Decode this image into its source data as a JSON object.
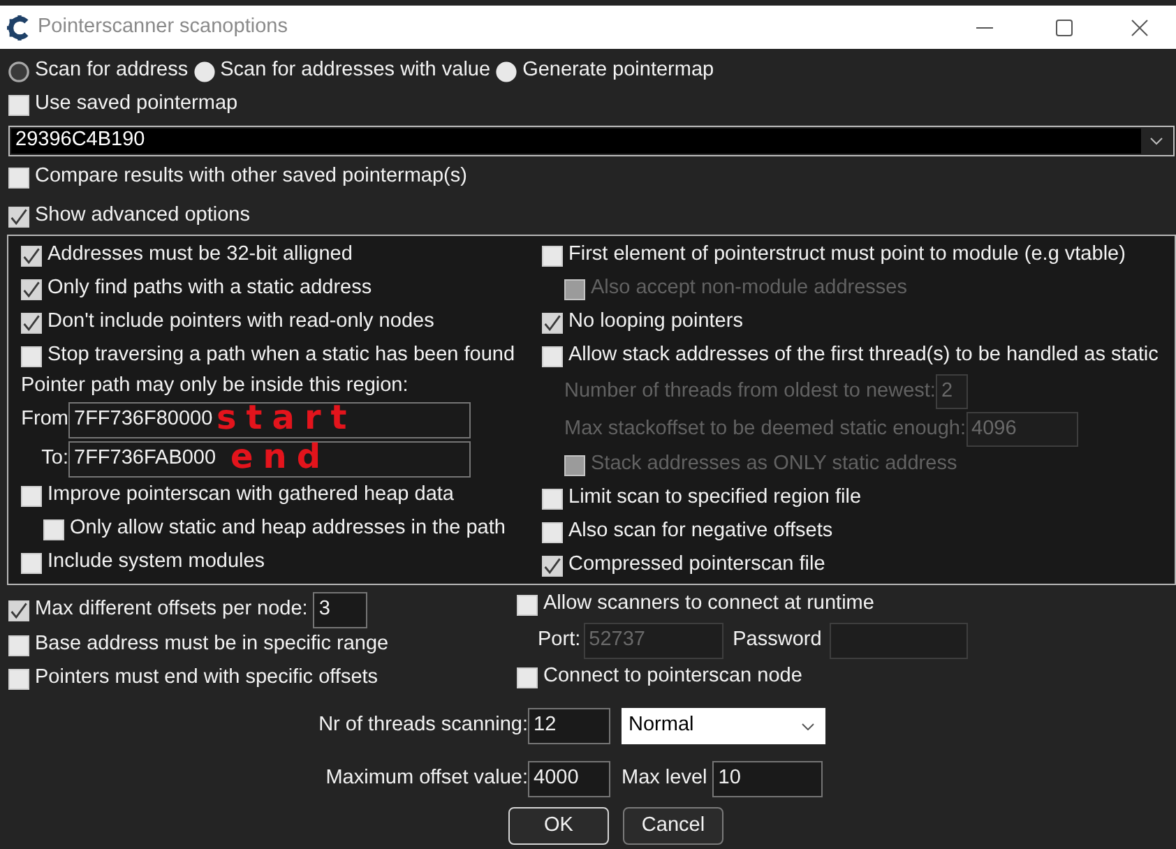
{
  "window": {
    "title": "Pointerscanner scanoptions"
  },
  "scan_modes": [
    {
      "label": "Scan for address",
      "selected": true
    },
    {
      "label": "Scan for addresses with value",
      "selected": false
    },
    {
      "label": "Generate pointermap",
      "selected": false
    }
  ],
  "use_saved_pointermap": {
    "label": "Use saved pointermap",
    "checked": false
  },
  "pointermap": {
    "value": "29396C4B190"
  },
  "compare_results": {
    "label": "Compare results with other saved pointermap(s)",
    "checked": false
  },
  "show_advanced_options": {
    "label": "Show advanced options",
    "checked": true
  },
  "advanced_options": {
    "left": [
      {
        "kind": "checkbox",
        "label": "Addresses must be 32-bit alligned",
        "checked": true,
        "disabled": false
      },
      {
        "kind": "checkbox",
        "label": "Only find paths with a static address",
        "checked": true,
        "disabled": false
      },
      {
        "kind": "checkbox",
        "label": "Don't include pointers with read-only nodes",
        "checked": true,
        "disabled": false
      },
      {
        "kind": "checkbox",
        "label": "Stop traversing a path when a static has been found",
        "checked": false,
        "disabled": false
      },
      {
        "kind": "text",
        "text": "Pointer path may only be inside this region:"
      },
      {
        "kind": "region_field",
        "label": "From",
        "value": "7FF736F80000",
        "annotation": "start"
      },
      {
        "kind": "region_field",
        "label": "To:",
        "value": "7FF736FAB000",
        "annotation": "end"
      },
      {
        "kind": "checkbox",
        "label": "Improve pointerscan with gathered heap data",
        "checked": false,
        "disabled": false,
        "children": [
          {
            "kind": "checkbox",
            "label": "Only allow static and heap addresses in the path",
            "checked": false,
            "disabled": false
          }
        ]
      },
      {
        "kind": "checkbox",
        "label": "Include system modules",
        "checked": false,
        "disabled": false
      }
    ],
    "right": [
      {
        "kind": "checkbox",
        "label": "First element of pointerstruct must point to module (e.g vtable)",
        "checked": false,
        "disabled": false,
        "children": [
          {
            "kind": "checkbox",
            "label": "Also accept non-module addresses",
            "checked": false,
            "disabled": true
          }
        ]
      },
      {
        "kind": "checkbox",
        "label": "No looping pointers",
        "checked": true,
        "disabled": false
      },
      {
        "kind": "checkbox",
        "label": "Allow stack addresses of the first thread(s) to be handled as static",
        "checked": false,
        "disabled": false,
        "children": [
          {
            "kind": "field",
            "label": "Number of threads from oldest to newest:",
            "value": "2",
            "disabled": true
          },
          {
            "kind": "field",
            "label": "Max stackoffset to be deemed static enough:",
            "value": "4096",
            "disabled": true
          },
          {
            "kind": "checkbox",
            "label": "Stack addresses as ONLY static address",
            "checked": false,
            "disabled": true
          }
        ]
      },
      {
        "kind": "checkbox",
        "label": "Limit scan to specified region file",
        "checked": false,
        "disabled": false
      },
      {
        "kind": "checkbox",
        "label": "Also scan for negative offsets",
        "checked": false,
        "disabled": false
      },
      {
        "kind": "checkbox",
        "label": "Compressed pointerscan file",
        "checked": true,
        "disabled": false
      }
    ]
  },
  "bottom_options": [
    {
      "kind": "checkbox_field",
      "label": "Max different offsets per node:",
      "checked": true,
      "disabled": false,
      "value": "3"
    },
    {
      "kind": "checkbox",
      "label": "Base address must be in specific range",
      "checked": false,
      "disabled": false
    },
    {
      "kind": "checkbox",
      "label": "Pointers must end with specific offsets",
      "checked": false,
      "disabled": false
    }
  ],
  "network": {
    "allow_scanners": {
      "label": "Allow scanners to connect at runtime",
      "checked": false
    },
    "port": {
      "label": "Port:",
      "value": "52737",
      "disabled": true
    },
    "password": {
      "label": "Password",
      "disabled": true
    },
    "connect_node": {
      "label": "Connect to pointerscan node",
      "checked": false
    }
  },
  "threads": {
    "label": "Nr of threads scanning:",
    "value": "12",
    "priority": "Normal"
  },
  "max_offset": {
    "label": "Maximum offset value:",
    "value": "4000"
  },
  "max_level": {
    "label": "Max level",
    "value": "10"
  },
  "buttons": [
    {
      "label": "OK",
      "default": true
    },
    {
      "label": "Cancel",
      "default": false
    }
  ]
}
